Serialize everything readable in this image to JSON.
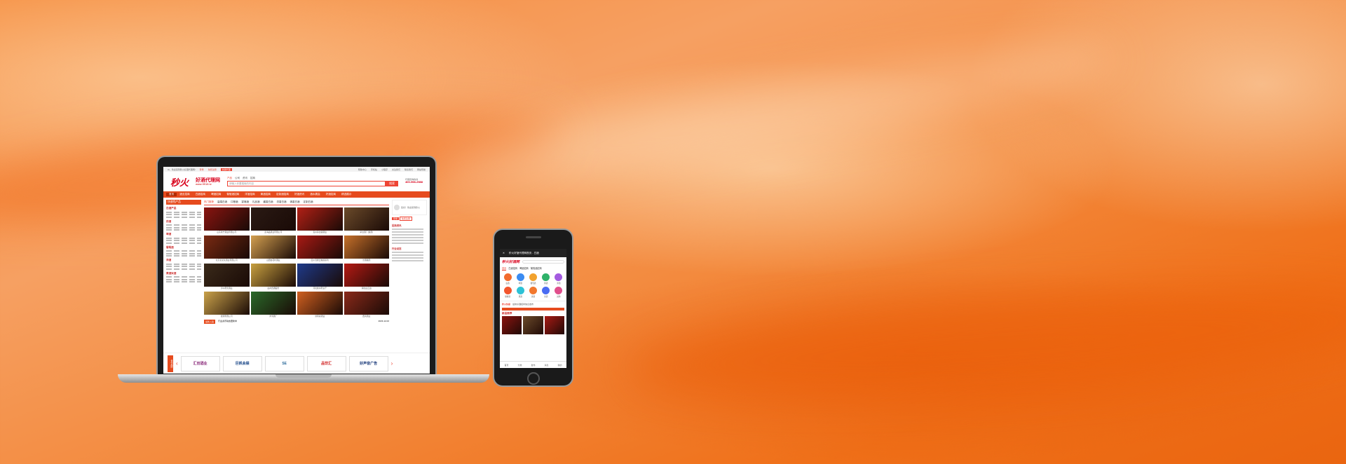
{
  "laptop": {
    "topbar": {
      "welcome": "Hi，欢迎来到秒火好酒代理网!",
      "login": "登录",
      "register": "免费注册",
      "hot": "热销代理",
      "links": [
        "帮助中心",
        "手机站",
        "小程序",
        "关注我们",
        "联系我们",
        "网站导航"
      ]
    },
    "header": {
      "logo": "秒火",
      "site_name": "好酒代理网",
      "domain": "www.9918.tv",
      "search_tabs": [
        "产品",
        "公司",
        "资讯",
        "招商"
      ],
      "search_placeholder": "请输入你要搜索的内容",
      "search_button": "搜索",
      "hotline_label": "代理咨询热线",
      "hotline": "400-998-2588"
    },
    "nav": [
      "首页",
      "酒业招商",
      "白酒招商",
      "啤酒招商",
      "葡萄酒招商",
      "洋酒招商",
      "黄酒招商",
      "定制酒招商",
      "好酒资讯",
      "酒水展会",
      "好酒招商",
      "精选展示"
    ],
    "sidebar_head": "快速找产品",
    "categories": [
      "白酒产品",
      "药酒",
      "啤酒",
      "葡萄酒",
      "洋酒",
      "黄酒米酒"
    ],
    "subtabs": [
      "热门推荐",
      "高端白酒",
      "口粮酒",
      "宴席酒",
      "礼品酒",
      "酱香白酒",
      "浓香白酒",
      "清香白酒",
      "定制白酒"
    ],
    "products": [
      "山东永宁酒业有限公司",
      "蓝海品酒业有限公司",
      "贵州茅台镇酒业",
      "茅台酒厂(集团)",
      "北京某某某酒业有限公司",
      "山西杏花村酒业",
      "四川宜宾五粮液系列",
      "汾酒集团",
      "泸州老窖酒业",
      "古井贡酒股份",
      "河北衡水老白干",
      "湖北白云边",
      "郎酒有限公司",
      "洋河酒厂",
      "剑南春酒业",
      "西凤酒业"
    ],
    "right": {
      "login_hint": "您好！欢迎来到秒火",
      "login_btn": "登录",
      "register_btn": "免费注册",
      "news_title": "招商资讯",
      "news2_title": "行业动态"
    },
    "ticker_label": "最新入驻",
    "ticker_text": "行业资讯动态更新中",
    "ticker_date": "2023-12-02",
    "brands_tag": "合作品牌",
    "brands": [
      "汇创酒业",
      "巨帆会展",
      "SE",
      "品饮汇",
      "好声音广告"
    ]
  },
  "phone": {
    "title": "秒火好酒代理网首页 - 白酒",
    "logo": "秒火好酒网",
    "tabs": [
      "首页",
      "白酒招商",
      "啤酒招商",
      "葡萄酒招商"
    ],
    "icons": [
      "白酒",
      "啤酒",
      "葡萄酒",
      "黄酒",
      "洋酒",
      "保健酒",
      "果酒",
      "清酒",
      "米酒",
      "其他"
    ],
    "news_tag": "秒火快报",
    "news_text": "最新好酒招商信息发布",
    "section": "新品推荐",
    "bottom": [
      "首页",
      "分类",
      "发布",
      "消息",
      "我的"
    ]
  },
  "colors": {
    "accent": "#e64b1e",
    "brand_red": "#d9001b",
    "icon_colors": [
      "#f26b2e",
      "#3b8cf2",
      "#f2a22e",
      "#2fb26a",
      "#a45be0",
      "#f2562e",
      "#2ec2d6",
      "#f2782e",
      "#4a6cf2",
      "#e04f8c"
    ],
    "product_colors": [
      "#8a1410",
      "#2a1a14",
      "#b22016",
      "#6b4a2a",
      "#7a2a12",
      "#d4a050",
      "#a81a14",
      "#c6702a",
      "#3a2a1a",
      "#c8a040",
      "#1e3a8a",
      "#b41a14",
      "#caa24a",
      "#2a6a2a",
      "#d06020",
      "#8a2a1a"
    ]
  }
}
